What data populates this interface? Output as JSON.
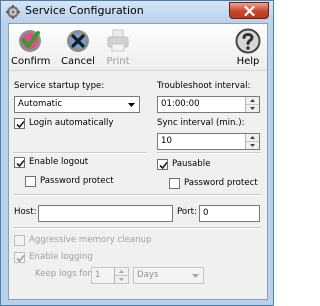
{
  "window": {
    "title": "Service Configuration"
  },
  "toolbar": {
    "confirm_label": "Confirm",
    "cancel_label": "Cancel",
    "print_label": "Print",
    "help_label": "Help"
  },
  "startup": {
    "label": "Service startup type:",
    "value": "Automatic",
    "login_auto_label": "Login automatically",
    "login_auto_checked": true
  },
  "troubleshoot": {
    "label": "Troubleshoot interval:",
    "value": "01:00:00"
  },
  "sync": {
    "label": "Sync interval (min.):",
    "value": "10"
  },
  "logout": {
    "enable_label": "Enable logout",
    "enable_checked": true,
    "password_label": "Password protect",
    "password_checked": false
  },
  "pausable": {
    "label": "Pausable",
    "checked": true,
    "password_label": "Password protect",
    "password_checked": false
  },
  "connection": {
    "host_label": "Host:",
    "host_value": "",
    "port_label": "Port:",
    "port_value": "0"
  },
  "memory": {
    "label": "Aggressive memory cleanup",
    "checked": false,
    "enabled": false
  },
  "logging": {
    "enable_label": "Enable logging",
    "checked": true,
    "enabled": false,
    "keep_label": "Keep logs for:",
    "keep_value": "1",
    "unit_value": "Days"
  },
  "colors": {
    "titlebar": "#b9d1ea",
    "close_button": "#c7462a",
    "window_bg": "#f0f0f0",
    "confirm_icon": "#3a9a2b",
    "help_icon": "#555555"
  }
}
